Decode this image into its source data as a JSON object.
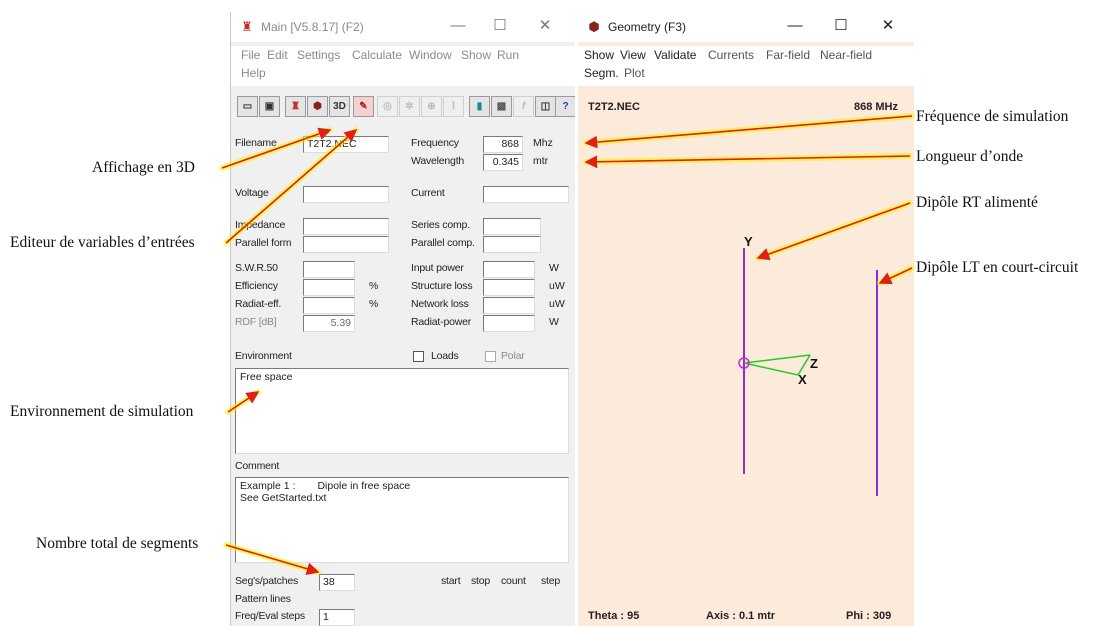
{
  "main_window": {
    "title": "Main [V5.8.17]  (F2)",
    "controls": {
      "minimize": "—",
      "maximize": "☐",
      "close": "✕"
    },
    "menu": [
      "File",
      "Edit",
      "Settings",
      "Calculate",
      "Window",
      "Show",
      "Run",
      "Help"
    ],
    "toolbar": [
      {
        "icon": "open-folder-icon",
        "glyph": "▭"
      },
      {
        "icon": "save-icon",
        "glyph": "▣"
      },
      {
        "icon": "main-window-icon",
        "glyph": "♜"
      },
      {
        "icon": "geometry-window-icon",
        "glyph": "⬢"
      },
      {
        "icon": "3d-view-icon",
        "glyph": "3D"
      },
      {
        "icon": "nec-editor-icon",
        "glyph": "✎"
      },
      {
        "icon": "pattern-icon",
        "glyph": "◎"
      },
      {
        "icon": "pattern-3d-icon",
        "glyph": "✲"
      },
      {
        "icon": "nearfield-icon",
        "glyph": "⊕"
      },
      {
        "icon": "currents-icon",
        "glyph": "⌇"
      },
      {
        "icon": "calculator-icon",
        "glyph": "▮"
      },
      {
        "icon": "optimizer-icon",
        "glyph": "▩"
      },
      {
        "icon": "function-icon",
        "glyph": "f"
      },
      {
        "icon": "book-icon",
        "glyph": "◫"
      },
      {
        "icon": "help-icon",
        "glyph": "?"
      }
    ],
    "fields": {
      "filename_label": "Filename",
      "filename_value": "T2T2.NEC",
      "frequency_label": "Frequency",
      "frequency_value": "868",
      "frequency_unit": "Mhz",
      "wavelength_label": "Wavelength",
      "wavelength_value": "0.345",
      "wavelength_unit": "mtr",
      "voltage_label": "Voltage",
      "current_label": "Current",
      "impedance_label": "Impedance",
      "series_comp_label": "Series comp.",
      "parallel_form_label": "Parallel form",
      "parallel_comp_label": "Parallel comp.",
      "swr_label": "S.W.R.50",
      "efficiency_label": "Efficiency",
      "efficiency_unit": "%",
      "radiat_eff_label": "Radiat-eff.",
      "radiat_eff_unit": "%",
      "rdf_label": "RDF [dB]",
      "rdf_value": "5.39",
      "input_power_label": "Input power",
      "input_power_unit": "W",
      "structure_loss_label": "Structure loss",
      "structure_loss_unit": "uW",
      "network_loss_label": "Network loss",
      "network_loss_unit": "uW",
      "radiat_power_label": "Radiat-power",
      "radiat_power_unit": "W",
      "environment_label": "Environment",
      "loads_label": "Loads",
      "polar_label": "Polar",
      "environment_value": "Free space",
      "comment_label": "Comment",
      "comment_line1_a": "Example 1 :",
      "comment_line1_b": "Dipole in free space",
      "comment_line2": "See GetStarted.txt",
      "segs_label": "Seg's/patches",
      "segs_value": "38",
      "pattern_lines_label": "Pattern lines",
      "freq_steps_label": "Freq/Eval steps",
      "freq_steps_value": "1",
      "start_label": "start",
      "stop_label": "stop",
      "count_label": "count",
      "step_label": "step"
    }
  },
  "geometry_window": {
    "title": "Geometry  (F3)",
    "controls": {
      "minimize": "—",
      "maximize": "☐",
      "close": "✕"
    },
    "menu": [
      "Show",
      "View",
      "Validate",
      "Currents",
      "Far-field",
      "Near-field",
      "Segm.",
      "Plot"
    ],
    "filename": "T2T2.NEC",
    "frequency": "868 MHz",
    "theta": "Theta : 95",
    "axis": "Axis : 0.1 mtr",
    "phi": "Phi : 309",
    "axis_labels": {
      "y": "Y",
      "z": "Z",
      "x": "X"
    },
    "colors": {
      "background": "#fceadb",
      "dipole": "#8a30c8",
      "axes": "#22cc22",
      "source": "#dd22dd"
    }
  },
  "annotations": {
    "affichage_3d": "Affichage en 3D",
    "editeur": "Editeur de variables d’entrées",
    "environnement": "Environnement de simulation",
    "segments": "Nombre total de segments",
    "frequence": "Fréquence de simulation",
    "longueur": "Longueur d’onde",
    "dipole_rt": "Dipôle RT alimenté",
    "dipole_lt": "Dipôle LT en court-circuit",
    "arrow_color": "#e02010",
    "highlight_color": "#fff200"
  }
}
